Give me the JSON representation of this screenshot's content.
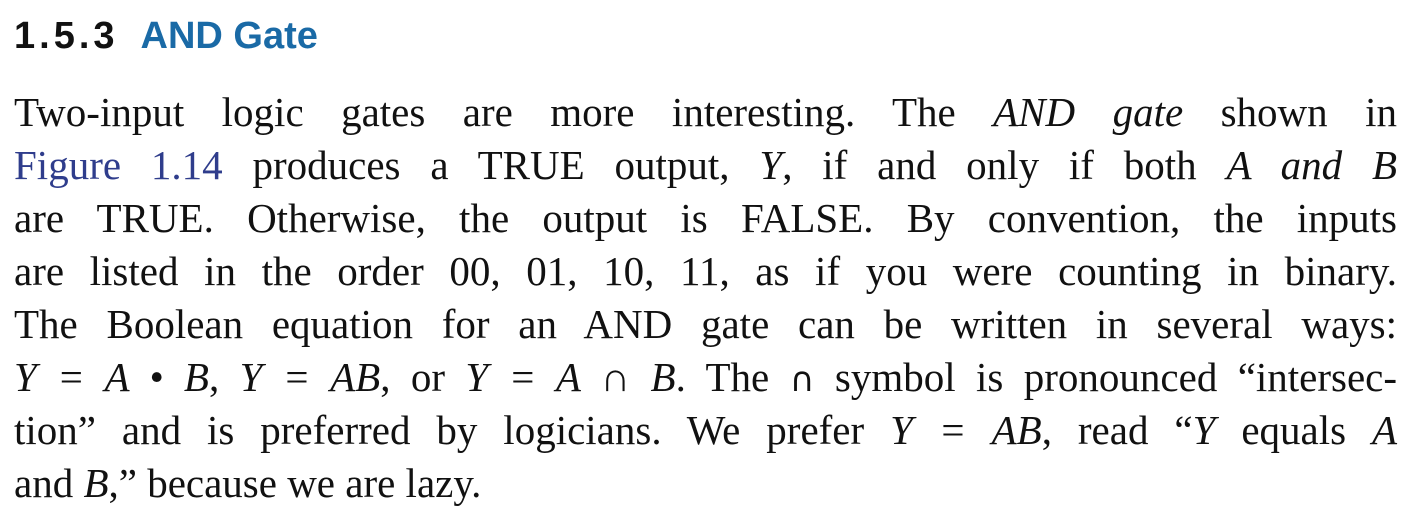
{
  "section": {
    "number": "1.5.3",
    "title": "AND Gate"
  },
  "paragraph": {
    "l1_a": "Two-input logic gates are more interesting. The",
    "l1_b": "AND gate",
    "l1_c": "shown in",
    "l2_link": "Figure 1.14",
    "l2_a": "produces a TRUE output,",
    "l2_b": "Y",
    "l2_c": ", if and only if both",
    "l2_d": "A and B",
    "l3": "are TRUE. Otherwise, the output is FALSE. By convention, the inputs",
    "l4": "are listed in the order 00, 01, 10, 11, as if you were counting in binary.",
    "l5": "The Boolean equation for an AND gate can be written in several ways:",
    "l6_eq1": "Y = A • B",
    "l6_a": ",",
    "l6_eq2": "Y = AB",
    "l6_b": ", or",
    "l6_eq3": "Y = A ∩ B",
    "l6_c": ". The",
    "l6_sym": "∩",
    "l6_d": "symbol is pronounced “intersec-",
    "l7_a": "tion” and is preferred by logicians. We prefer",
    "l7_eq": "Y = AB",
    "l7_b": ", read “",
    "l7_c": "Y",
    "l7_d": "equals",
    "l7_e": "A",
    "l8_a": "and",
    "l8_b": "B",
    "l8_c": ",” because we are lazy."
  }
}
